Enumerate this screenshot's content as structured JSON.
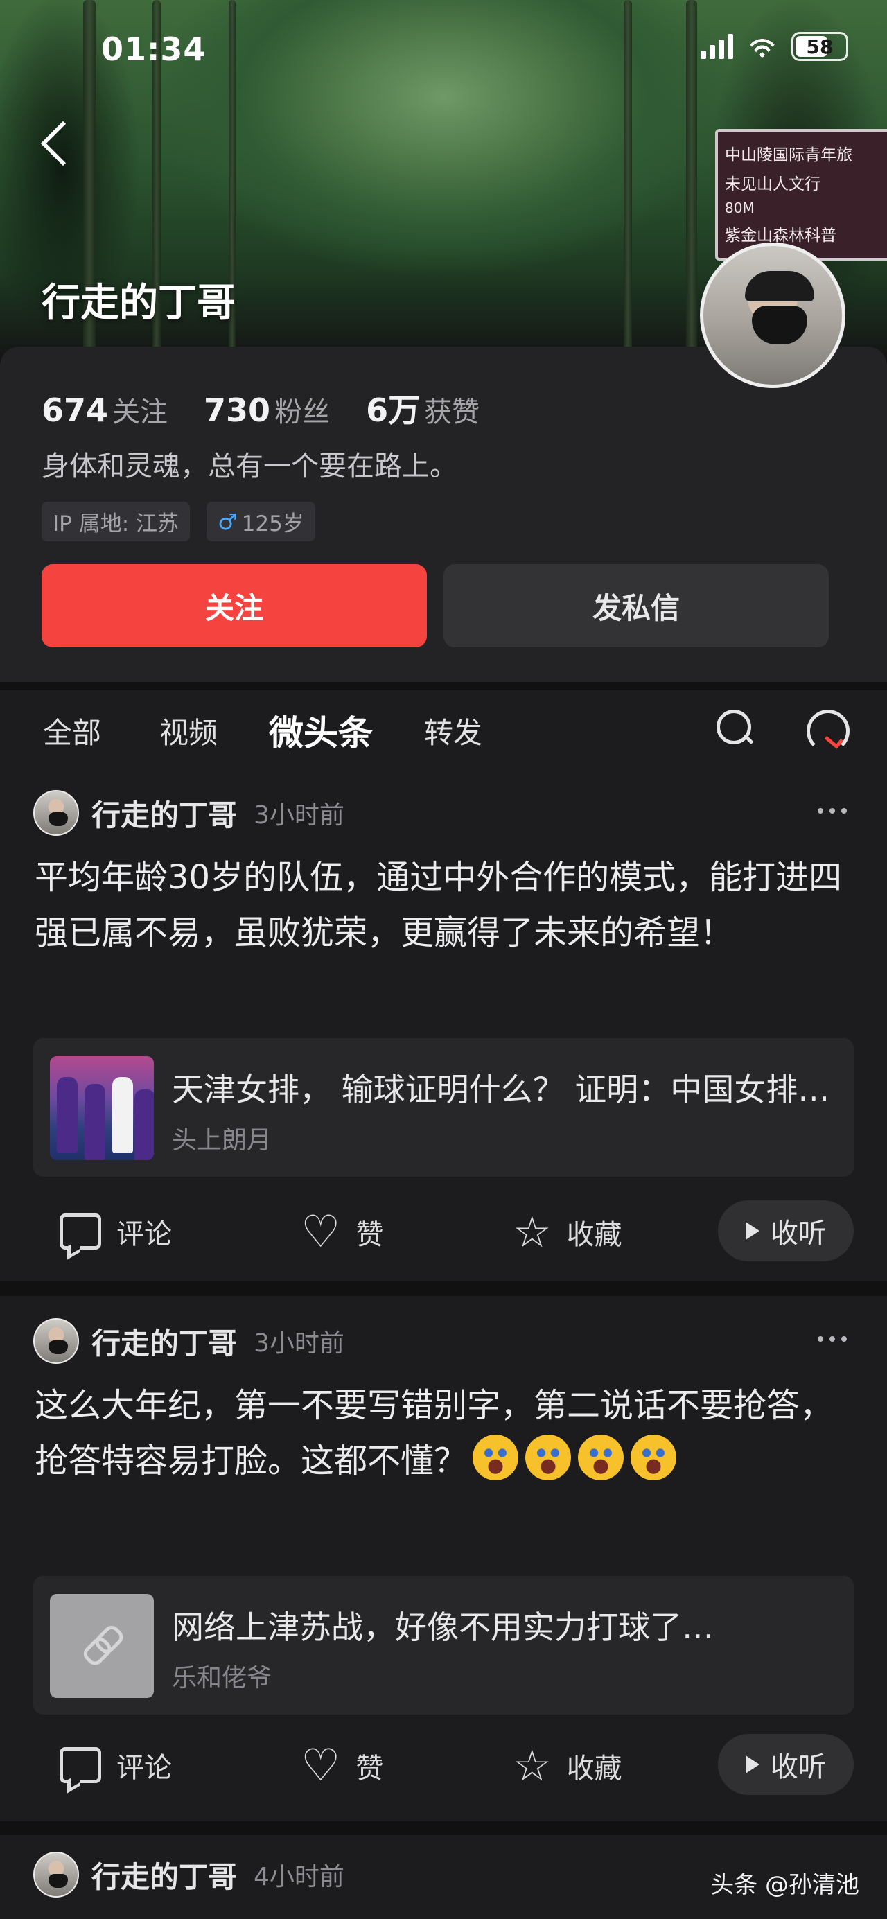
{
  "status_bar": {
    "time": "01:34",
    "battery": "58"
  },
  "cover_sign": {
    "lines": [
      "中山陵国际青年旅",
      "未见山人文行",
      "紫金山森林科普"
    ],
    "distance": "80M"
  },
  "profile": {
    "name": "行走的丁哥",
    "stats": [
      {
        "num": "674",
        "label": "关注"
      },
      {
        "num": "730",
        "label": "粉丝"
      },
      {
        "num": "6万",
        "label": "获赞"
      }
    ],
    "bio": "身体和灵魂，总有一个要在路上。",
    "ip": "IP 属地: 江苏",
    "age": "125岁",
    "follow_label": "关注",
    "message_label": "发私信"
  },
  "tabs": [
    "全部",
    "视频",
    "微头条",
    "转发"
  ],
  "active_tab": "微头条",
  "posts": [
    {
      "author": "行走的丁哥",
      "time": "3小时前",
      "text": "平均年龄30岁的队伍，通过中外合作的模式，能打进四强已属不易，虽败犹荣，更赢得了未来的希望！",
      "ref_title": "天津女排， 输球证明什么？ 证明：中国女排…",
      "ref_source": "头上朗月",
      "ref_thumb": "volleyball-photo"
    },
    {
      "author": "行走的丁哥",
      "time": "3小时前",
      "text": "这么大年纪，第一不要写错别字，第二说话不要抢答，抢答特容易打脸。这都不懂？",
      "emoji_count": 4,
      "ref_title": "网络上津苏战，好像不用实力打球了…",
      "ref_source": "乐和佬爷",
      "ref_thumb": "link-icon"
    },
    {
      "author": "行走的丁哥",
      "time": "4小时前"
    }
  ],
  "actions": {
    "comment": "评论",
    "like": "赞",
    "collect": "收藏",
    "listen": "收听"
  },
  "watermark": "头条 @孙清池"
}
